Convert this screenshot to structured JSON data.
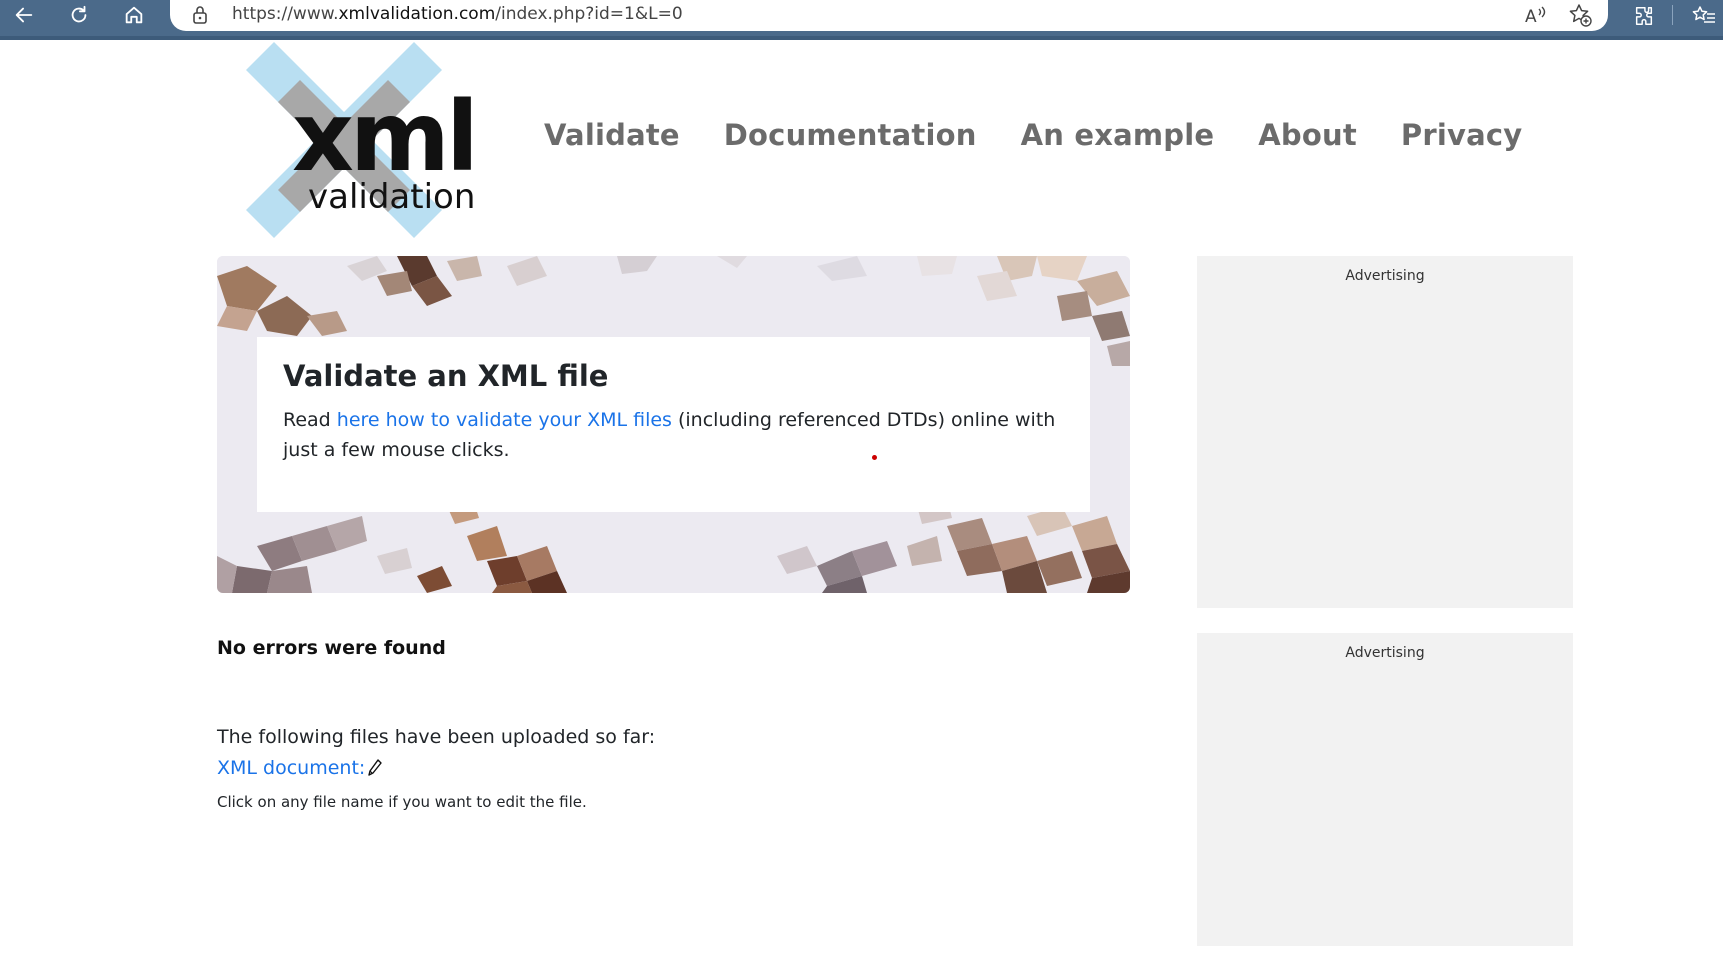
{
  "browser": {
    "url_prefix": "https://www.",
    "url_domain": "xmlvalidation.com",
    "url_path": "/index.php?id=1&L=0"
  },
  "logo": {
    "mark": "xml",
    "word": "validation"
  },
  "nav": {
    "items": [
      "Validate",
      "Documentation",
      "An example",
      "About",
      "Privacy"
    ]
  },
  "hero": {
    "title": "Validate an XML file",
    "text_before": "Read ",
    "link_text": "here how to validate your XML files",
    "text_after": " (including referenced DTDs) online with just a few mouse clicks."
  },
  "result": {
    "heading": "No errors were found",
    "uploaded_label": "The following files have been uploaded so far:",
    "file_link": "XML document:",
    "hint": "Click on any file name if you want to edit the file."
  },
  "ads": {
    "label_1": "Advertising",
    "label_2": "Advertising"
  },
  "colors": {
    "link": "#1a73e8",
    "nav_text": "#6b6b6b",
    "chrome": "#4b6a8a",
    "logo_cross": "#b9dff2"
  }
}
